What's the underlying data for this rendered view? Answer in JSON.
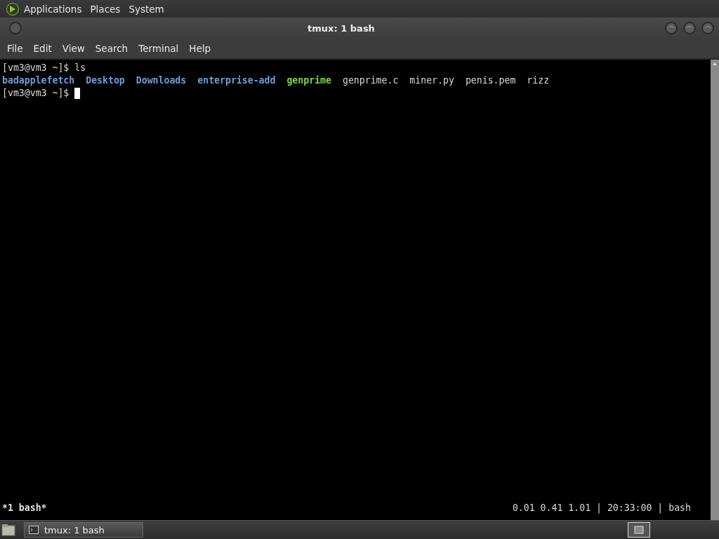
{
  "top_panel": {
    "menus": [
      "Applications",
      "Places",
      "System"
    ]
  },
  "window": {
    "title": "tmux: 1 bash"
  },
  "menubar": [
    "File",
    "Edit",
    "View",
    "Search",
    "Terminal",
    "Help"
  ],
  "terminal": {
    "lines": [
      {
        "prompt": "[vm3@vm3 ~]$",
        "command": "ls",
        "cursor": false
      },
      {
        "entries": [
          {
            "name": "badapplefetch",
            "kind": "dir"
          },
          {
            "name": "Desktop",
            "kind": "dir"
          },
          {
            "name": "Downloads",
            "kind": "dir"
          },
          {
            "name": "enterprise-add",
            "kind": "dir"
          },
          {
            "name": "genprime",
            "kind": "executable"
          },
          {
            "name": "genprime.c",
            "kind": "file"
          },
          {
            "name": "miner.py",
            "kind": "file"
          },
          {
            "name": "penis.pem",
            "kind": "file"
          },
          {
            "name": "rizz",
            "kind": "file"
          }
        ]
      },
      {
        "prompt": "[vm3@vm3 ~]$",
        "cursor": true
      }
    ],
    "status_left": "*1 bash*",
    "status_right": "0.01 0.41 1.01 | 20:33:00 | bash"
  },
  "taskbar": {
    "tasks": [
      {
        "label": "tmux: 1 bash",
        "selected": true
      }
    ]
  }
}
